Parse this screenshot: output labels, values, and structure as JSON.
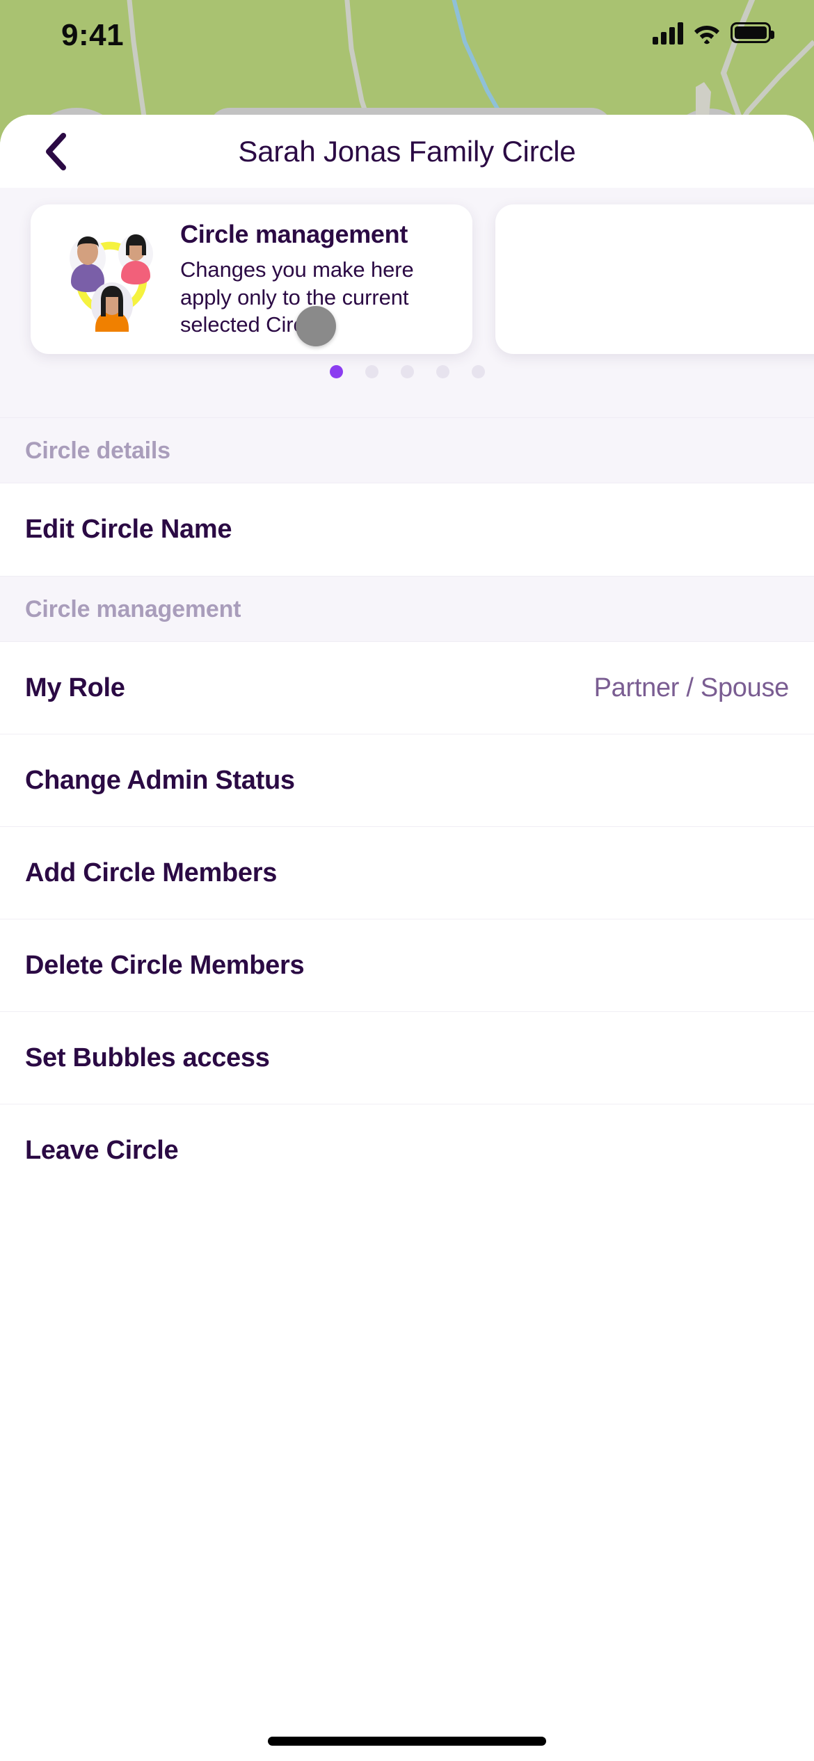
{
  "status_bar": {
    "time": "9:41",
    "cellular_icon": "signal-bars-icon",
    "wifi_icon": "wifi-icon",
    "battery_icon": "battery-full-icon"
  },
  "header": {
    "back_icon": "chevron-left-icon",
    "title": "Sarah Jonas Family Circle"
  },
  "carousel": {
    "cards": [
      {
        "illustration": "three-people-circle-illustration",
        "title": "Circle management",
        "description": "Changes you make here apply only to the current selected Circle."
      }
    ],
    "dots_total": 5,
    "dots_active_index": 0,
    "active_dot_color": "#8b3df0",
    "inactive_dot_color": "#e7e3ee"
  },
  "sections": [
    {
      "heading": "Circle details",
      "rows": [
        {
          "label": "Edit Circle Name",
          "value": ""
        }
      ]
    },
    {
      "heading": "Circle management",
      "rows": [
        {
          "label": "My Role",
          "value": "Partner / Spouse"
        },
        {
          "label": "Change Admin Status",
          "value": ""
        },
        {
          "label": "Add Circle Members",
          "value": ""
        },
        {
          "label": "Delete Circle Members",
          "value": ""
        },
        {
          "label": "Set Bubbles access",
          "value": ""
        },
        {
          "label": "Leave Circle",
          "value": ""
        }
      ]
    }
  ],
  "colors": {
    "primary_text": "#2b0a44",
    "muted_heading": "#a99dbb",
    "value_text": "#7a5d92",
    "accent": "#8b3df0",
    "sheet_bg": "#ffffff",
    "section_bg": "#f7f5fa",
    "map_green": "#a9c271"
  },
  "home_indicator": "home-indicator-bar"
}
